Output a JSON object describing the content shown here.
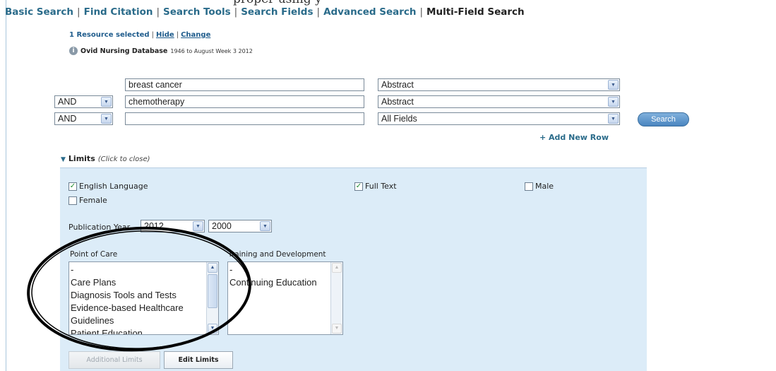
{
  "nav": {
    "links": [
      "Basic Search",
      "Find Citation",
      "Search Tools",
      "Search Fields",
      "Advanced Search"
    ],
    "current": "Multi-Field Search",
    "separator": "|"
  },
  "resource": {
    "selected_text": "1 Resource selected",
    "separator": "|",
    "hide": "Hide",
    "change": "Change",
    "info_icon": "i",
    "db_name": "Ovid Nursing Database",
    "db_dates": "1946 to August Week 3 2012"
  },
  "search_rows": [
    {
      "operator": "",
      "term": "breast cancer",
      "field": "Abstract"
    },
    {
      "operator": "AND",
      "term": "chemotherapy",
      "field": "Abstract"
    },
    {
      "operator": "AND",
      "term": "",
      "field": "All Fields"
    }
  ],
  "search_button": "Search",
  "add_row": "+ Add New Row",
  "limits": {
    "heading": "Limits",
    "hint": "(Click to close)",
    "checkboxes": [
      {
        "label": "English Language",
        "checked": true
      },
      {
        "label": "Full Text",
        "checked": true
      },
      {
        "label": "Male",
        "checked": false
      },
      {
        "label": "Female",
        "checked": false
      }
    ],
    "check_mark": "✓",
    "pub_year_label": "Publication Year",
    "pub_year_from": "2012",
    "pub_year_to": "2000",
    "point_of_care_label": "Point of Care",
    "point_of_care_items": [
      "-",
      "Care Plans",
      "Diagnosis Tools and Tests",
      "Evidence-based Healthcare",
      "Guidelines",
      "Patient Education"
    ],
    "training_label": "Training and Development",
    "training_items": [
      "-",
      "Continuing Education"
    ],
    "additional_limits": "Additional Limits",
    "edit_limits": "Edit Limits"
  },
  "icons": {
    "dropdown": "chevron-down-icon",
    "scroll_up": "scroll-up-icon",
    "scroll_down": "scroll-down-icon",
    "info": "info-icon"
  },
  "colors": {
    "link": "#2a6b8a",
    "panel_bg": "#dcecf8",
    "search_button": "#4a85c0",
    "annotation": "#000000"
  }
}
